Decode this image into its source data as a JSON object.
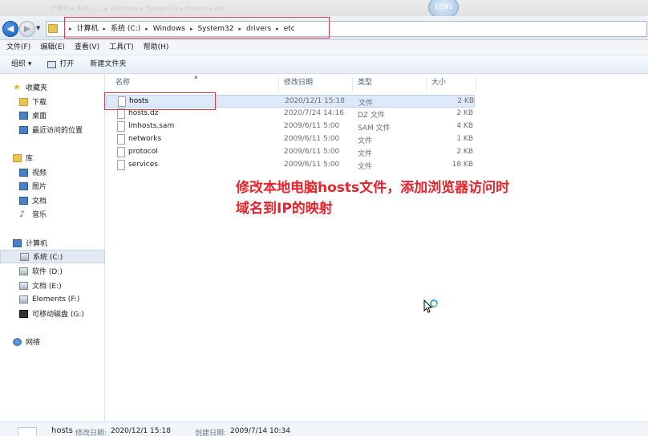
{
  "window": {
    "title_faded": "计算机 ▸ 系统 (C:) ▸ Windows ▸ System32 ▸ drivers ▸ etc",
    "clock": "11:41"
  },
  "address": {
    "crumbs": [
      "计算机",
      "系统 (C:)",
      "Windows",
      "System32",
      "drivers",
      "etc"
    ]
  },
  "menu": [
    "文件(F)",
    "编辑(E)",
    "查看(V)",
    "工具(T)",
    "帮助(H)"
  ],
  "toolbar": {
    "organize": "组织 ▾",
    "open": "打开",
    "new_folder": "新建文件夹"
  },
  "nav": {
    "favorites": "收藏夹",
    "downloads": "下载",
    "desktop": "桌面",
    "recent": "最近访问的位置",
    "libraries": "库",
    "videos": "视频",
    "pictures": "图片",
    "documents": "文档",
    "music": "音乐",
    "computer": "计算机",
    "drive_c": "系统 (C:)",
    "drive_d": "软件 (D:)",
    "drive_e": "文档 (E:)",
    "drive_f": "Elements (F:)",
    "drive_g": "可移动磁盘 (G:)",
    "network": "网络"
  },
  "columns": {
    "name": "名称",
    "modified": "修改日期",
    "type": "类型",
    "size": "大小"
  },
  "files": [
    {
      "name": "hosts",
      "modified": "2020/12/1 15:18",
      "type": "文件",
      "size": "2 KB"
    },
    {
      "name": "hosts.dz",
      "modified": "2020/7/24 14:16",
      "type": "DZ 文件",
      "size": "2 KB"
    },
    {
      "name": "lmhosts.sam",
      "modified": "2009/6/11 5:00",
      "type": "SAM 文件",
      "size": "4 KB"
    },
    {
      "name": "networks",
      "modified": "2009/6/11 5:00",
      "type": "文件",
      "size": "1 KB"
    },
    {
      "name": "protocol",
      "modified": "2009/6/11 5:00",
      "type": "文件",
      "size": "2 KB"
    },
    {
      "name": "services",
      "modified": "2009/6/11 5:00",
      "type": "文件",
      "size": "18 KB"
    }
  ],
  "annotation": {
    "line1": "修改本地电脑hosts文件，添加浏览器访问时",
    "line2": "域名到IP的映射"
  },
  "status": {
    "name": "hosts",
    "modified_label": "修改日期:",
    "modified": "2020/12/1 15:18",
    "created_label": "创建日期:",
    "created": "2009/7/14 10:34"
  },
  "colors": {
    "highlight_border": "#e03a4a",
    "annotation_text": "#e8232b",
    "selection": "#dde9f8"
  }
}
